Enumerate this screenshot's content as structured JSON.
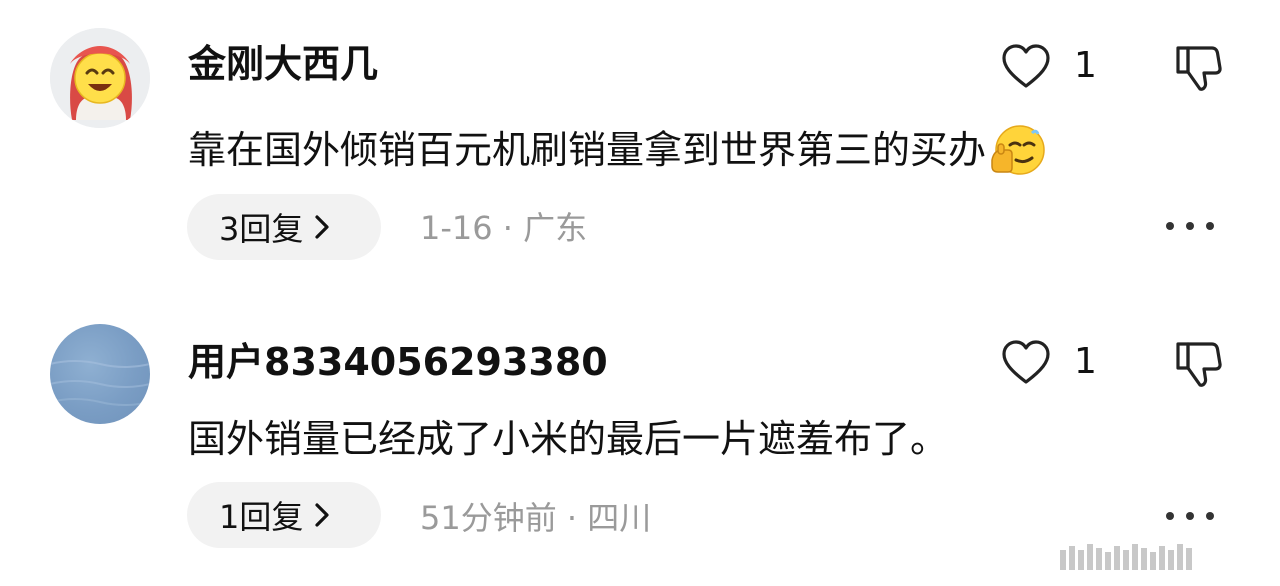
{
  "comments": [
    {
      "username": "金刚大西几",
      "text": "靠在国外倾销百元机刷销量拿到世界第三的买办",
      "likes": "1",
      "replies_label": "3回复",
      "meta": "1-16 · 广东",
      "avatar_icon": "laughing-face-avatar",
      "emoji_icon": "smirk-thumbs-up-emoji"
    },
    {
      "username": "用户8334056293380",
      "text": "国外销量已经成了小米的最后一片遮羞布了。",
      "likes": "1",
      "replies_label": "1回复",
      "meta": "51分钟前 · 四川",
      "avatar_icon": "blue-water-avatar"
    }
  ],
  "icons": {
    "like": "heart-outline-icon",
    "dislike": "thumbs-down-outline-icon",
    "more": "more-dots-icon",
    "chevron": "chevron-right-icon"
  },
  "colors": {
    "meta_text": "#9a9a9a",
    "reply_button_bg": "#f2f2f2"
  }
}
